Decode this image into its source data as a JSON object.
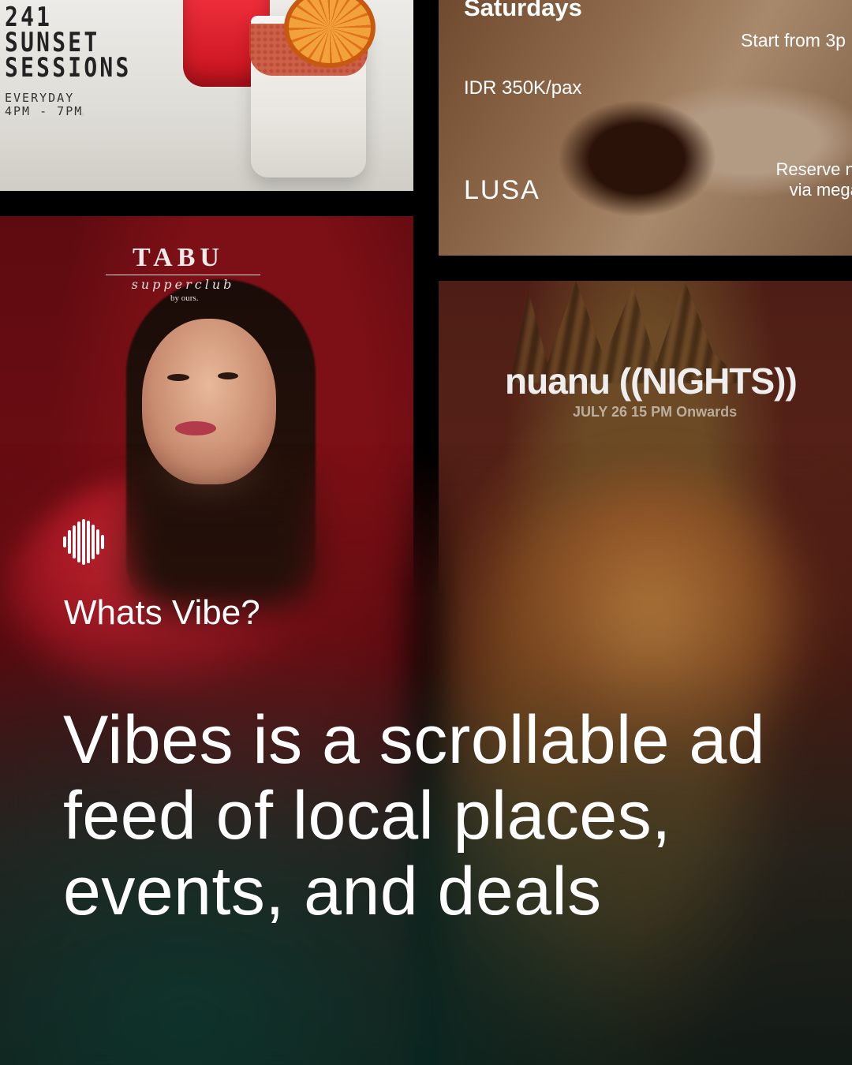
{
  "tiles": {
    "sunset": {
      "title": "241\nSUNSET\nSESSIONS",
      "time": "EVERYDAY\n4PM - 7PM"
    },
    "lusa": {
      "day": "Saturdays",
      "start": "Start from 3p",
      "price": "IDR 350K/pax",
      "brand": "LUSA",
      "reserve": "Reserve no\nvia megat"
    },
    "tabu": {
      "logo": "TABU",
      "script": "supperclub",
      "by": "by ours."
    },
    "nuanu": {
      "logo": "nuanu ((NIGHTS))",
      "date": "JULY 26 15 PM Onwards"
    }
  },
  "content": {
    "icon": "waveform-icon",
    "kicker": "Whats Vibe?",
    "headline": "Vibes is a scrollable ad feed of local places, events, and deals"
  },
  "colors": {
    "text": "#ffffff",
    "tabu_bg": "#6e0e14",
    "nuanu_bg": "#5a2318",
    "bottom_tint": "#0c2620"
  }
}
